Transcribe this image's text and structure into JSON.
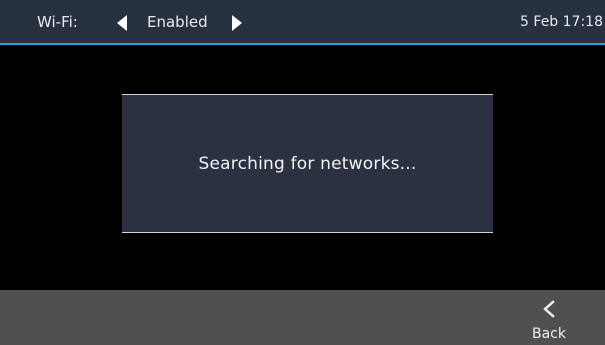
{
  "status_bar": {
    "wifi_label": "Wi-Fi:",
    "wifi_value": "Enabled",
    "datetime": "5 Feb 17:18",
    "left_arrow_icon": "triangle-left-icon",
    "right_arrow_icon": "triangle-right-icon"
  },
  "dialog": {
    "message": "Searching for networks..."
  },
  "softkeys": {
    "back_icon": "chevron-left-icon",
    "back_label": "Back"
  },
  "colors": {
    "status_bar_bg": "#27303f",
    "status_bar_accent": "#2e9cd6",
    "dialog_bg": "#2b3140",
    "softkey_bar_bg": "#505050",
    "screen_bg": "#000000"
  }
}
